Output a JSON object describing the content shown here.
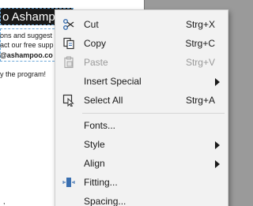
{
  "document": {
    "title": "o Ashampoo",
    "line1": "ons and suggest",
    "line2": "act our free supp",
    "line3": "@ashampoo.co",
    "line4": "y the program!",
    "trailing_mark": ","
  },
  "menu": {
    "items": [
      {
        "label": "Cut",
        "shortcut": "Strg+X",
        "icon": "scissors-icon"
      },
      {
        "label": "Copy",
        "shortcut": "Strg+C",
        "icon": "copy-icon"
      },
      {
        "label": "Paste",
        "shortcut": "Strg+V",
        "icon": "paste-icon",
        "disabled": true
      },
      {
        "label": "Insert Special",
        "submenu": true
      },
      {
        "label": "Select All",
        "shortcut": "Strg+A",
        "icon": "select-all-icon"
      },
      {
        "label": "Fonts..."
      },
      {
        "label": "Style",
        "submenu": true
      },
      {
        "label": "Align",
        "submenu": true
      },
      {
        "label": "Fitting...",
        "icon": "fitting-icon"
      },
      {
        "label": "Spacing..."
      }
    ]
  },
  "colors": {
    "menu_background": "#f2f2f2",
    "icon_blue": "#3a6fb0",
    "disabled_text": "#9a9a9a"
  }
}
